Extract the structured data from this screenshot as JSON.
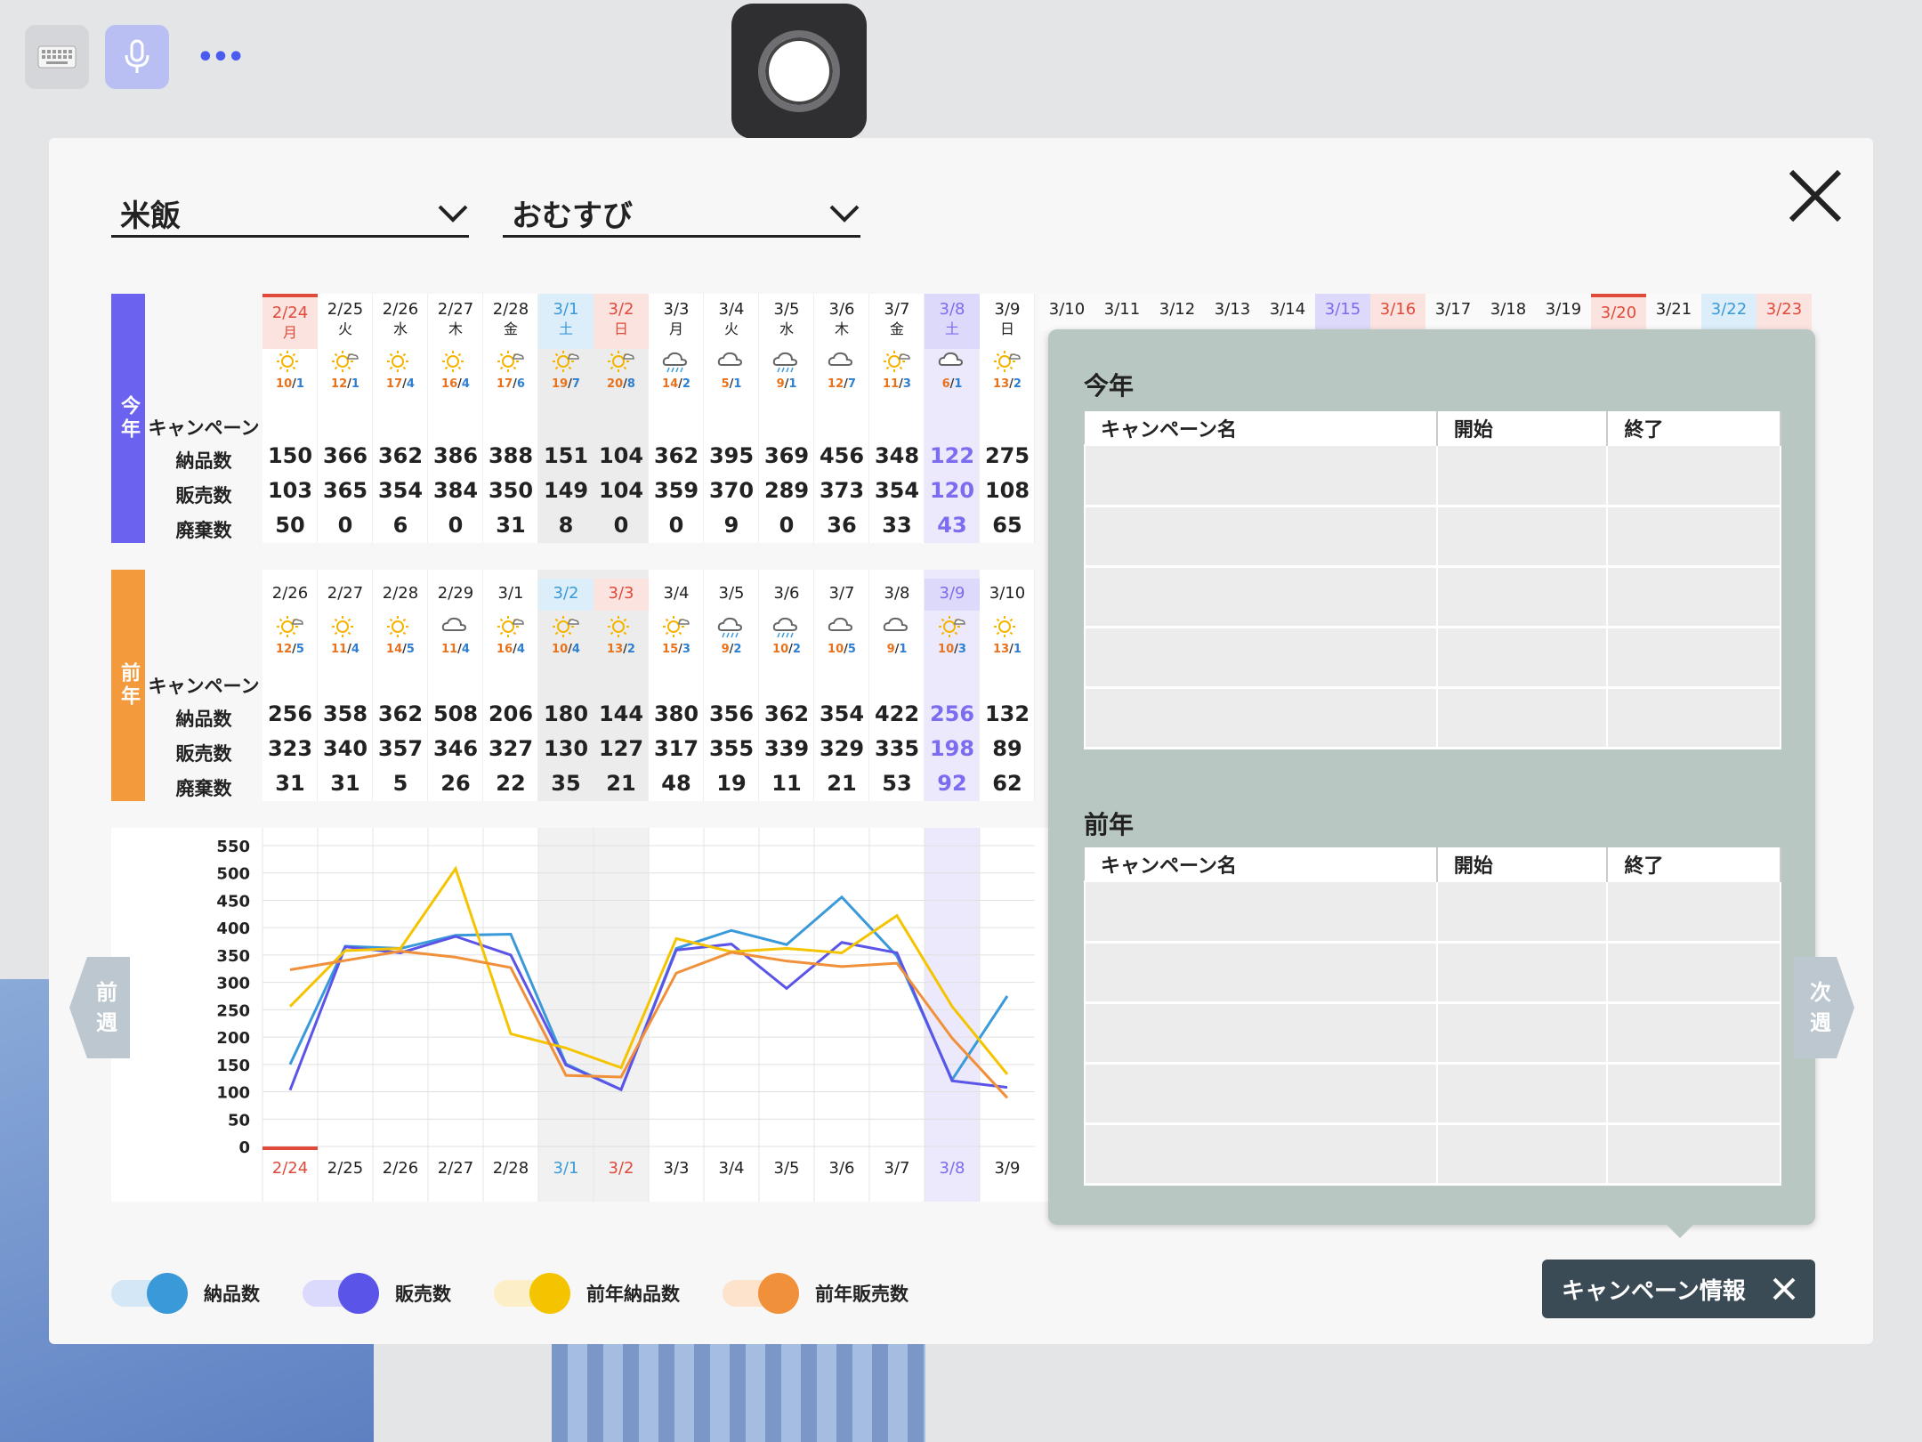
{
  "toolbar": {
    "more_label": "•••"
  },
  "selectors": {
    "category": "米飯",
    "subcategory": "おむすび"
  },
  "this_year": {
    "tab": "今年",
    "row_labels": [
      "キャンペーン",
      "納品数",
      "販売数",
      "廃棄数"
    ],
    "dates": [
      {
        "d": "2/24",
        "w": "月"
      },
      {
        "d": "2/25",
        "w": "火"
      },
      {
        "d": "2/26",
        "w": "水"
      },
      {
        "d": "2/27",
        "w": "木"
      },
      {
        "d": "2/28",
        "w": "金"
      },
      {
        "d": "3/1",
        "w": "土"
      },
      {
        "d": "3/2",
        "w": "日"
      },
      {
        "d": "3/3",
        "w": "月"
      },
      {
        "d": "3/4",
        "w": "火"
      },
      {
        "d": "3/5",
        "w": "水"
      },
      {
        "d": "3/6",
        "w": "木"
      },
      {
        "d": "3/7",
        "w": "金"
      },
      {
        "d": "3/8",
        "w": "土"
      },
      {
        "d": "3/9",
        "w": "日"
      }
    ],
    "more_dates": [
      "3/10",
      "3/11",
      "3/12",
      "3/13",
      "3/14",
      "3/15",
      "3/16",
      "3/17",
      "3/18",
      "3/19",
      "3/20",
      "3/21",
      "3/22",
      "3/23"
    ],
    "weather": [
      {
        "icon": "sun",
        "hi": "10",
        "lo": "1"
      },
      {
        "icon": "sun-cloud",
        "hi": "12",
        "lo": "1"
      },
      {
        "icon": "sun",
        "hi": "17",
        "lo": "4"
      },
      {
        "icon": "sun",
        "hi": "16",
        "lo": "4"
      },
      {
        "icon": "sun-cloud",
        "hi": "17",
        "lo": "6"
      },
      {
        "icon": "sun-cloud",
        "hi": "19",
        "lo": "7"
      },
      {
        "icon": "sun-cloud",
        "hi": "20",
        "lo": "8"
      },
      {
        "icon": "cloud-rain",
        "hi": "14",
        "lo": "2"
      },
      {
        "icon": "cloud",
        "hi": "5",
        "lo": "1"
      },
      {
        "icon": "cloud-rain",
        "hi": "9",
        "lo": "1"
      },
      {
        "icon": "cloud",
        "hi": "12",
        "lo": "7"
      },
      {
        "icon": "sun-cloud",
        "hi": "11",
        "lo": "3"
      },
      {
        "icon": "cloud",
        "hi": "6",
        "lo": "1"
      },
      {
        "icon": "sun-cloud",
        "hi": "13",
        "lo": "2"
      }
    ],
    "delivered": [
      "150",
      "366",
      "362",
      "386",
      "388",
      "151",
      "104",
      "362",
      "395",
      "369",
      "456",
      "348",
      "122",
      "275"
    ],
    "sold": [
      "103",
      "365",
      "354",
      "384",
      "350",
      "149",
      "104",
      "359",
      "370",
      "289",
      "373",
      "354",
      "120",
      "108"
    ],
    "waste": [
      "50",
      "0",
      "6",
      "0",
      "31",
      "8",
      "0",
      "0",
      "9",
      "0",
      "36",
      "33",
      "43",
      "65"
    ]
  },
  "last_year": {
    "tab": "前年",
    "row_labels": [
      "キャンペーン",
      "納品数",
      "販売数",
      "廃棄数"
    ],
    "dates": [
      "2/26",
      "2/27",
      "2/28",
      "2/29",
      "3/1",
      "3/2",
      "3/3",
      "3/4",
      "3/5",
      "3/6",
      "3/7",
      "3/8",
      "3/9",
      "3/10"
    ],
    "weather": [
      {
        "icon": "sun-cloud",
        "hi": "12",
        "lo": "5"
      },
      {
        "icon": "sun",
        "hi": "11",
        "lo": "4"
      },
      {
        "icon": "sun",
        "hi": "14",
        "lo": "5"
      },
      {
        "icon": "cloud",
        "hi": "11",
        "lo": "4"
      },
      {
        "icon": "sun-cloud",
        "hi": "16",
        "lo": "4"
      },
      {
        "icon": "sun-cloud",
        "hi": "10",
        "lo": "4"
      },
      {
        "icon": "sun",
        "hi": "13",
        "lo": "2"
      },
      {
        "icon": "sun-cloud",
        "hi": "15",
        "lo": "3"
      },
      {
        "icon": "cloud-rain",
        "hi": "9",
        "lo": "2"
      },
      {
        "icon": "cloud-rain",
        "hi": "10",
        "lo": "2"
      },
      {
        "icon": "cloud",
        "hi": "10",
        "lo": "5"
      },
      {
        "icon": "cloud",
        "hi": "9",
        "lo": "1"
      },
      {
        "icon": "sun-cloud",
        "hi": "10",
        "lo": "3"
      },
      {
        "icon": "sun",
        "hi": "13",
        "lo": "1"
      }
    ],
    "delivered": [
      "256",
      "358",
      "362",
      "508",
      "206",
      "180",
      "144",
      "380",
      "356",
      "362",
      "354",
      "422",
      "256",
      "132"
    ],
    "sold": [
      "323",
      "340",
      "357",
      "346",
      "327",
      "130",
      "127",
      "317",
      "355",
      "339",
      "329",
      "335",
      "198",
      "89"
    ],
    "waste": [
      "31",
      "31",
      "5",
      "26",
      "22",
      "35",
      "21",
      "48",
      "19",
      "11",
      "21",
      "53",
      "92",
      "62"
    ]
  },
  "nav": {
    "prev": "前週",
    "next": "次週"
  },
  "chart_data": {
    "type": "line",
    "categories": [
      "2/24",
      "2/25",
      "2/26",
      "2/27",
      "2/28",
      "3/1",
      "3/2",
      "3/3",
      "3/4",
      "3/5",
      "3/6",
      "3/7",
      "3/8",
      "3/9"
    ],
    "y_ticks": [
      "550",
      "500",
      "450",
      "400",
      "350",
      "300",
      "250",
      "200",
      "150",
      "100",
      "50",
      "0"
    ],
    "ylim": [
      0,
      550
    ],
    "series": [
      {
        "name": "納品数",
        "color": "#3a9ad9",
        "values": [
          150,
          366,
          362,
          386,
          388,
          151,
          104,
          362,
          395,
          369,
          456,
          348,
          122,
          275
        ]
      },
      {
        "name": "販売数",
        "color": "#5b54e8",
        "values": [
          103,
          365,
          354,
          384,
          350,
          149,
          104,
          359,
          370,
          289,
          373,
          354,
          120,
          108
        ]
      },
      {
        "name": "前年納品数",
        "color": "#f5c400",
        "values": [
          256,
          358,
          362,
          508,
          206,
          180,
          144,
          380,
          356,
          362,
          354,
          422,
          256,
          132
        ]
      },
      {
        "name": "前年販売数",
        "color": "#f0903a",
        "values": [
          323,
          340,
          357,
          346,
          327,
          130,
          127,
          317,
          355,
          339,
          329,
          335,
          198,
          89
        ]
      }
    ]
  },
  "campaign": {
    "this_year_title": "今年",
    "last_year_title": "前年",
    "headers": [
      "キャンペーン名",
      "開始",
      "終了"
    ],
    "button_label": "キャンペーン情報"
  },
  "colors": {
    "this_year": "#6b62f0",
    "last_year": "#f39a3c",
    "saturday": "#3a9ad9",
    "sunday": "#e04a3a",
    "highlight": "#7b6cf0"
  }
}
